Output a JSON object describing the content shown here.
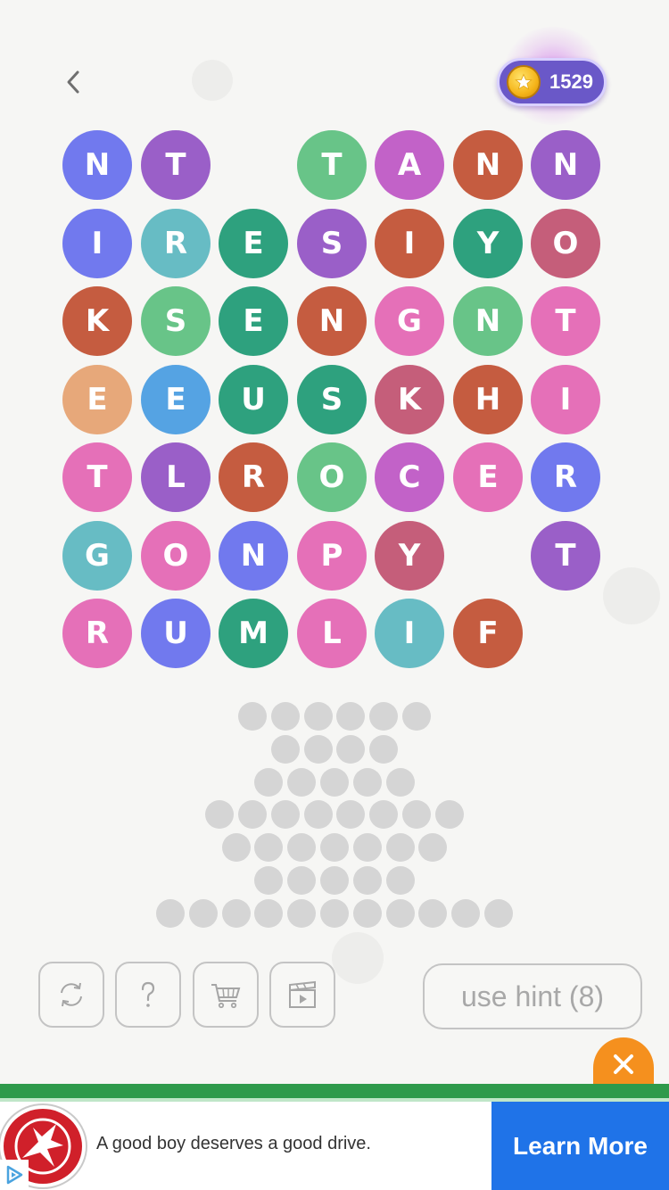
{
  "header": {
    "back_icon": "chevron-left-icon",
    "coins": "1529",
    "coin_icon": "gold-star-coin-icon"
  },
  "board": {
    "rows": [
      [
        {
          "letter": "N",
          "color": "#7179ee"
        },
        {
          "letter": "T",
          "color": "#9a5fc8"
        },
        null,
        {
          "letter": "T",
          "color": "#68c488"
        },
        {
          "letter": "A",
          "color": "#c262c8"
        },
        {
          "letter": "N",
          "color": "#c55c40"
        },
        {
          "letter": "N",
          "color": "#9a5fc8"
        }
      ],
      [
        {
          "letter": "I",
          "color": "#7179ee"
        },
        {
          "letter": "R",
          "color": "#67bcc4"
        },
        {
          "letter": "E",
          "color": "#2ea17e"
        },
        {
          "letter": "S",
          "color": "#9a5fc8"
        },
        {
          "letter": "I",
          "color": "#c55c40"
        },
        {
          "letter": "Y",
          "color": "#2ea17e"
        },
        {
          "letter": "O",
          "color": "#c55e7a"
        }
      ],
      [
        {
          "letter": "K",
          "color": "#c55c40"
        },
        {
          "letter": "S",
          "color": "#68c488"
        },
        {
          "letter": "E",
          "color": "#2ea17e"
        },
        {
          "letter": "N",
          "color": "#c55c40"
        },
        {
          "letter": "G",
          "color": "#e570b8"
        },
        {
          "letter": "N",
          "color": "#68c488"
        },
        {
          "letter": "T",
          "color": "#e570b8"
        }
      ],
      [
        {
          "letter": "E",
          "color": "#e7a87a"
        },
        {
          "letter": "E",
          "color": "#55a3e3"
        },
        {
          "letter": "U",
          "color": "#2ea17e"
        },
        {
          "letter": "S",
          "color": "#2ea17e"
        },
        {
          "letter": "K",
          "color": "#c55e7a"
        },
        {
          "letter": "H",
          "color": "#c55c40"
        },
        {
          "letter": "I",
          "color": "#e570b8"
        }
      ],
      [
        {
          "letter": "T",
          "color": "#e570b8"
        },
        {
          "letter": "L",
          "color": "#9a5fc8"
        },
        {
          "letter": "R",
          "color": "#c55c40"
        },
        {
          "letter": "O",
          "color": "#68c488"
        },
        {
          "letter": "C",
          "color": "#c262c8"
        },
        {
          "letter": "E",
          "color": "#e570b8"
        },
        {
          "letter": "R",
          "color": "#7179ee"
        }
      ],
      [
        {
          "letter": "G",
          "color": "#67bcc4"
        },
        {
          "letter": "O",
          "color": "#e570b8"
        },
        {
          "letter": "N",
          "color": "#7179ee"
        },
        {
          "letter": "P",
          "color": "#e570b8"
        },
        {
          "letter": "Y",
          "color": "#c55e7a"
        },
        null,
        {
          "letter": "T",
          "color": "#9a5fc8"
        }
      ],
      [
        {
          "letter": "R",
          "color": "#e570b8"
        },
        {
          "letter": "U",
          "color": "#7179ee"
        },
        {
          "letter": "M",
          "color": "#2ea17e"
        },
        {
          "letter": "L",
          "color": "#e570b8"
        },
        {
          "letter": "I",
          "color": "#67bcc4"
        },
        {
          "letter": "F",
          "color": "#c55c40"
        },
        null
      ]
    ]
  },
  "answer_slots": {
    "rows": [
      6,
      4,
      5,
      8,
      7,
      5,
      11
    ],
    "slot_color": "#d5d5d5"
  },
  "toolbar": {
    "buttons": [
      {
        "name": "shuffle-button",
        "icon": "refresh-icon"
      },
      {
        "name": "help-button",
        "icon": "question-mark-icon"
      },
      {
        "name": "shop-button",
        "icon": "shopping-cart-icon"
      },
      {
        "name": "video-button",
        "icon": "clapperboard-icon"
      }
    ],
    "hint_label": "use hint (8)"
  },
  "ad": {
    "close_icon": "close-icon",
    "text": "A good boy deserves a good drive.",
    "cta": "Learn More",
    "cta_color": "#1f73e8",
    "accent": "#2e9a4b",
    "adchoices_icon": "adchoices-icon"
  }
}
